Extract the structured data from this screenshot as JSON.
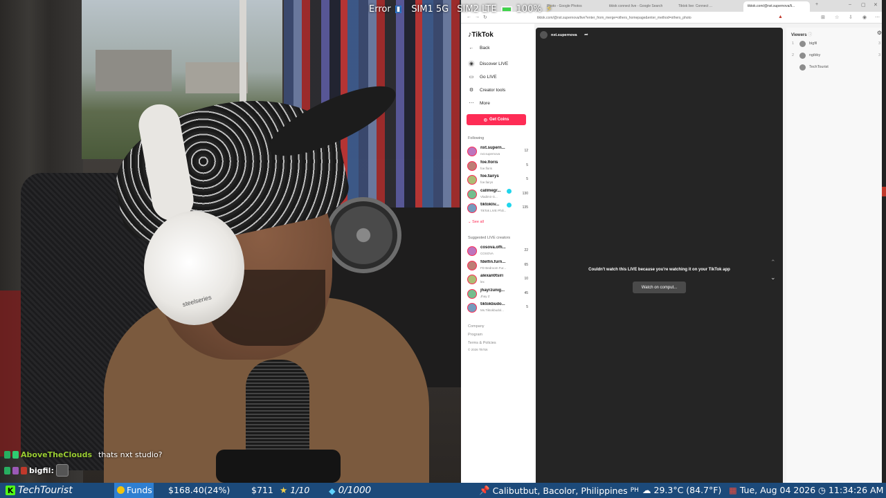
{
  "status_bar": {
    "error": "Error",
    "sim1": "SIM1 5G",
    "sim2": "SIM2 LTE",
    "battery": "100%"
  },
  "browser": {
    "tabs": [
      "Photo - Google Photos",
      "tiktok connect live - Google Search",
      "Tiktok live: Connect ...",
      "tiktok.com/@nxt.supernova/li..."
    ],
    "url": "tiktok.com/@nxt.supernova/live?enter_from_merge=others_homepage&enter_method=others_photo"
  },
  "tiktok": {
    "logo": "TikTok",
    "back": "Back",
    "nav": [
      "Discover LIVE",
      "Go LIVE",
      "Creator tools",
      "More"
    ],
    "get_coins": "Get Coins",
    "following_label": "Following",
    "following": [
      {
        "name": "nxt.supern...",
        "sub": "nxt.supernova",
        "count": "12",
        "verified": false
      },
      {
        "name": "foe.floris",
        "sub": "foe.floris",
        "count": "5",
        "verified": false
      },
      {
        "name": "foe.fairys",
        "sub": "foe.fairys",
        "count": "5",
        "verified": false
      },
      {
        "name": "callmegr...",
        "sub": "Vladimir G...",
        "count": "130",
        "verified": true
      },
      {
        "name": "tiktokliv...",
        "sub": "TikTok LIVE Phili...",
        "count": "135",
        "verified": true
      }
    ],
    "see_all": "See all",
    "suggested_label": "Suggested LIVE creators",
    "suggested": [
      {
        "name": "cosova.offi...",
        "sub": "COSOVA",
        "count": "22"
      },
      {
        "name": "fdelfin.furn...",
        "sub": "FD Bedroom Fur...",
        "count": "65"
      },
      {
        "name": "alexan0tsiri",
        "sub": "lex",
        "count": "10"
      },
      {
        "name": "jhayrzunig...",
        "sub": "Jhay Z",
        "count": "45"
      },
      {
        "name": "tiktokbudo...",
        "sub": "Ms.Tiktokbudol...",
        "count": "5"
      }
    ],
    "footer": [
      "Company",
      "Program",
      "Terms & Policies",
      "© 2026 TikTok"
    ],
    "host_name": "nxt.supernova",
    "live_message": "Couldn't watch this LIVE because you're watching it on your TikTok app",
    "watch_button": "Watch on comput...",
    "viewers_label": "Viewers",
    "viewers": [
      {
        "rank": "1",
        "name": "bigfil",
        "score": "3"
      },
      {
        "rank": "2",
        "name": "ngibby",
        "score": "3"
      },
      {
        "rank": "",
        "name": "TechTourist",
        "score": ""
      }
    ]
  },
  "chat": [
    {
      "user": "AboveTheClouds",
      "message": "thats nxt studio?"
    },
    {
      "user": "bigfil:",
      "message": ""
    }
  ],
  "ticker": {
    "channel": "TechTourist",
    "funds_label": "Funds",
    "balance": "$168.40(24%)",
    "cash": "$711",
    "stars": "1/10",
    "gems": "0/1000",
    "location": "Calibutbut, Bacolor, Philippines",
    "country": "PH",
    "weather": "29.3°C (84.7°F)",
    "date": "Tue, Aug 04 2026",
    "time": "11:34:26 AM"
  }
}
